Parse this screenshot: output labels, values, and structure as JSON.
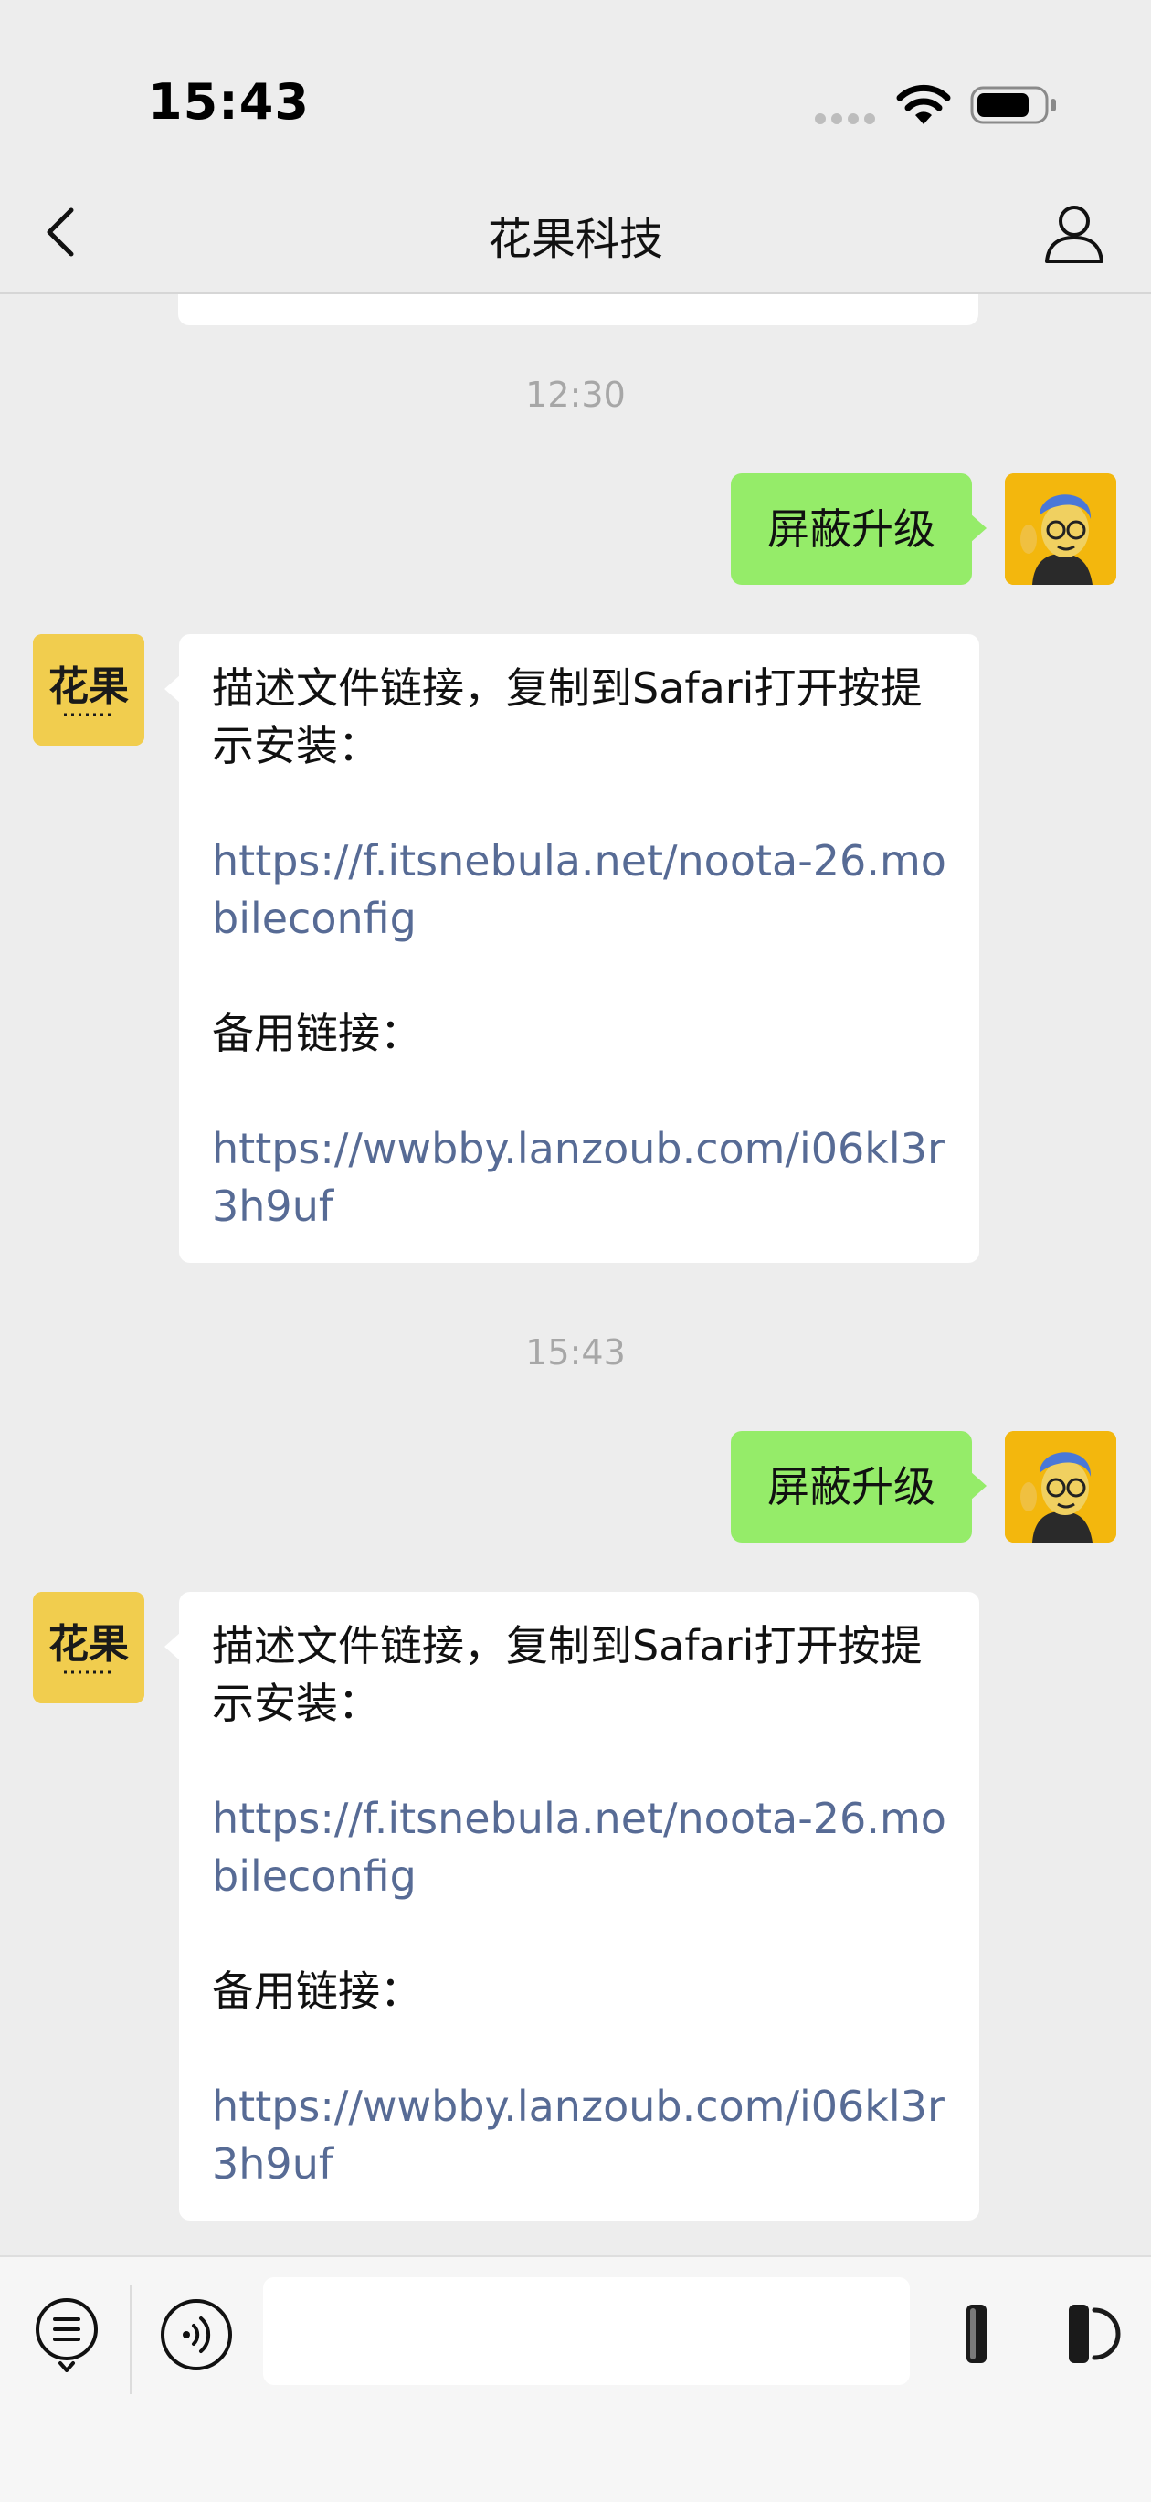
{
  "status_bar": {
    "time": "15:43"
  },
  "nav": {
    "title": "花果科技"
  },
  "messages": {
    "timestamp_1": "12:30",
    "sent_1": "屏蔽升级",
    "reply_1": {
      "intro": "描述文件链接，复制到Safari打开按提示安装：",
      "link_1": "https://f.itsnebula.net/noota-26.mobileconfig",
      "backup_label": "备用链接：",
      "link_2": "https://wwbby.lanzoub.com/i06kl3r3h9uf"
    },
    "timestamp_2": "15:43",
    "sent_2": "屏蔽升级",
    "reply_2": {
      "intro": "描述文件链接，复制到Safari打开按提示安装：",
      "link_1": "https://f.itsnebula.net/noota-26.mobileconfig",
      "backup_label": "备用链接：",
      "link_2": "https://wwbby.lanzoub.com/i06kl3r3h9uf"
    }
  },
  "bot_avatar_text": "花果",
  "colors": {
    "sent_bubble": "#95ec69",
    "link": "#576b95",
    "background": "#ededed"
  }
}
